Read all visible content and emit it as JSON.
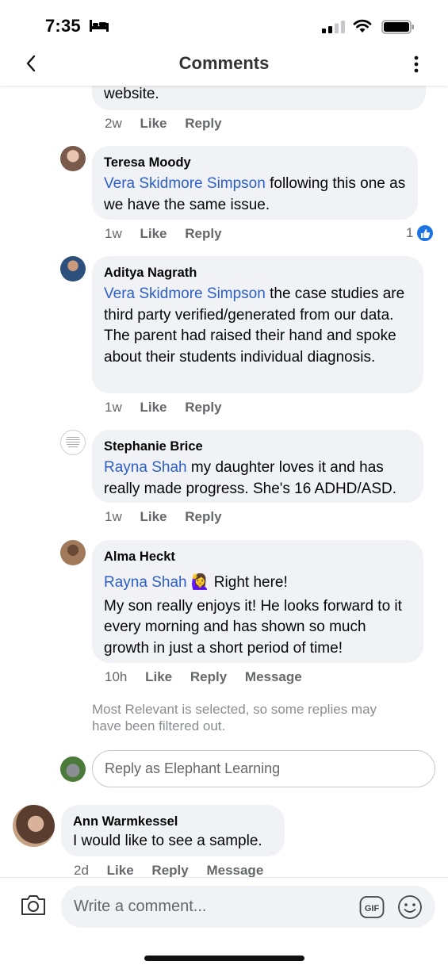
{
  "status_bar": {
    "time": "7:35"
  },
  "header": {
    "title": "Comments"
  },
  "comments": [
    {
      "text": "website.",
      "time": "2w",
      "like": "Like",
      "reply": "Reply"
    },
    {
      "name": "Teresa Moody",
      "mention": "Vera Skidmore Simpson",
      "text": " following this one as we have the same issue.",
      "time": "1w",
      "like": "Like",
      "reply": "Reply",
      "reaction_count": "1"
    },
    {
      "name": "Aditya Nagrath",
      "mention": "Vera Skidmore Simpson",
      "text": " the case studies are third party verified/generated from our data. The parent had raised their hand and spoke about their students individual diagnosis.",
      "time": "1w",
      "like": "Like",
      "reply": "Reply"
    },
    {
      "name": "Stephanie Brice",
      "mention": "Rayna Shah",
      "text": " my daughter loves it and has really made progress. She's 16 ADHD/ASD.",
      "time": "1w",
      "like": "Like",
      "reply": "Reply"
    },
    {
      "name": "Alma Heckt",
      "mention": "Rayna Shah",
      "emoji": "🙋‍♀️",
      "text_line1": " Right here!",
      "text": "My son really enjoys it! He looks forward to it every morning and has shown so much growth in just a short period of time!",
      "time": "10h",
      "like": "Like",
      "reply": "Reply",
      "message": "Message"
    },
    {
      "name": "Ann Warmkessel",
      "text": "I would like to see a sample.",
      "time": "2d",
      "like": "Like",
      "reply": "Reply",
      "message": "Message"
    }
  ],
  "filter_note": "Most Relevant is selected, so some replies may have been filtered out.",
  "reply_box": {
    "placeholder": "Reply as Elephant Learning"
  },
  "composer": {
    "placeholder": "Write a comment..."
  },
  "colors": {
    "mention": "#2d5fc9",
    "bubble": "#f0f2f5",
    "like_blue": "#1b74e4"
  }
}
